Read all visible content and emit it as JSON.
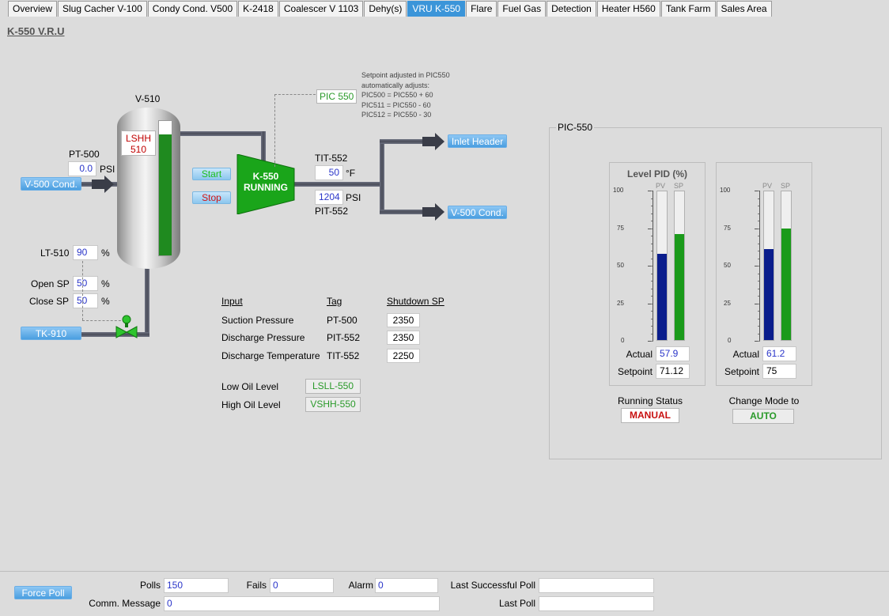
{
  "tabs": [
    {
      "label": "Overview",
      "active": false
    },
    {
      "label": "Slug Cacher V-100",
      "active": false
    },
    {
      "label": "Condy Cond. V500",
      "active": false
    },
    {
      "label": "K-2418",
      "active": false
    },
    {
      "label": "Coalescer V 1103",
      "active": false
    },
    {
      "label": "Dehy(s)",
      "active": false
    },
    {
      "label": "VRU K-550",
      "active": true
    },
    {
      "label": "Flare",
      "active": false
    },
    {
      "label": "Fuel Gas",
      "active": false
    },
    {
      "label": "Detection",
      "active": false
    },
    {
      "label": "Heater H560",
      "active": false
    },
    {
      "label": "Tank Farm",
      "active": false
    },
    {
      "label": "Sales Area",
      "active": false
    }
  ],
  "page_title": "K-550 V.R.U",
  "vessel": {
    "name": "V-510",
    "lshh_line1": "LSHH",
    "lshh_line2": "510",
    "level_percent": 90
  },
  "pt500": {
    "label": "PT-500",
    "value": "0.0",
    "unit": "PSI"
  },
  "lt510": {
    "label": "LT-510",
    "value": "90",
    "unit": "%"
  },
  "open_sp": {
    "label": "Open SP",
    "value": "50",
    "unit": "%"
  },
  "close_sp": {
    "label": "Close SP",
    "value": "50",
    "unit": "%"
  },
  "buttons": {
    "v500_in": "V-500 Cond.",
    "tk910": "TK-910",
    "start": "Start",
    "stop": "Stop",
    "inlet_header": "Inlet Header",
    "v500_out": "V-500 Cond.",
    "force_poll": "Force Poll"
  },
  "compressor": {
    "line1": "K-550",
    "line2": "RUNNING",
    "color": "#1aa51a"
  },
  "tit552": {
    "label": "TIT-552",
    "value": "50",
    "unit": "°F"
  },
  "pit552": {
    "label": "PIT-552",
    "value": "1204",
    "unit": "PSI"
  },
  "pic550_tag": "PIC 550",
  "setpoint_note": [
    "Setpoint adjusted in PIC550",
    "automatically adjusts:",
    "PIC500 = PIC550 + 60",
    "PIC511 = PIC550 - 60",
    "PIC512 = PIC550 - 30"
  ],
  "shutdown_table": {
    "headers": {
      "input": "Input",
      "tag": "Tag",
      "sp": "Shutdown SP"
    },
    "rows": [
      {
        "input": "Suction Pressure",
        "tag": "PT-500",
        "sp": "2350"
      },
      {
        "input": "Discharge Pressure",
        "tag": "PIT-552",
        "sp": "2350"
      },
      {
        "input": "Discharge Temperature",
        "tag": "TIT-552",
        "sp": "2250"
      }
    ]
  },
  "oil_levels": [
    {
      "label": "Low Oil Level",
      "button": "LSLL-550"
    },
    {
      "label": "High Oil Level",
      "button": "VSHH-550"
    }
  ],
  "pic_panel": {
    "title": "PIC-550",
    "groups": [
      {
        "title": "Level PID (%)",
        "pv_label": "PV",
        "sp_label": "SP",
        "pv_percent": 57.9,
        "sp_percent": 71.12,
        "actual_label": "Actual",
        "actual": "57.9",
        "setpoint_label": "Setpoint",
        "setpoint": "71.12"
      },
      {
        "title": "",
        "pv_label": "PV",
        "sp_label": "SP",
        "pv_percent": 61.2,
        "sp_percent": 75,
        "actual_label": "Actual",
        "actual": "61.2",
        "setpoint_label": "Setpoint",
        "setpoint": "75"
      }
    ],
    "ticks": [
      "100",
      "75",
      "50",
      "25",
      "0"
    ],
    "pv_color": "#0a1d8c",
    "sp_color": "#1a9a1a",
    "running_status_label": "Running Status",
    "running_status_value": "MANUAL",
    "change_mode_label": "Change Mode to",
    "change_mode_value": "AUTO"
  },
  "footer": {
    "polls_label": "Polls",
    "polls": "150",
    "fails_label": "Fails",
    "fails": "0",
    "alarm_label": "Alarm",
    "alarm": "0",
    "last_success_label": "Last Successful Poll",
    "last_success": "",
    "comm_label": "Comm. Message",
    "comm": "0",
    "last_poll_label": "Last Poll",
    "last_poll": ""
  }
}
